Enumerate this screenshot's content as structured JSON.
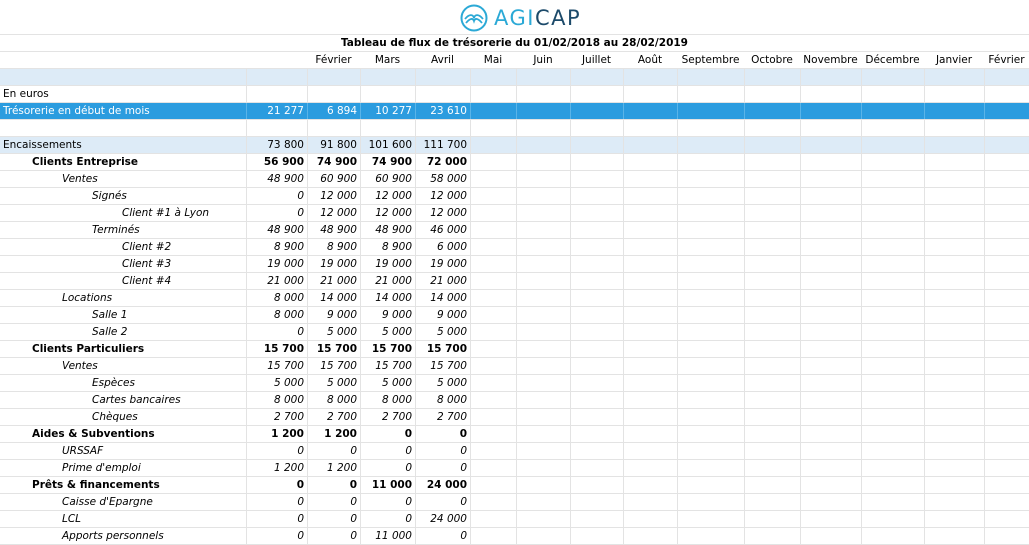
{
  "brand": {
    "part1": "AGI",
    "part2": "CAP",
    "logo_icon": "agicap-wave-icon"
  },
  "title": "Tableau de flux de trésorerie du 01/02/2018 au 28/02/2019",
  "months": [
    "Février",
    "Mars",
    "Avril",
    "Mai",
    "Juin",
    "Juillet",
    "Août",
    "Septembre",
    "Octobre",
    "Novembre",
    "Décembre",
    "Janvier",
    "Février"
  ],
  "colors": {
    "highlight": "#2b9cdf",
    "light": "#ddebf7",
    "grid": "#e3e3e3",
    "brand_light": "#2ba9d6",
    "brand_dark": "#1c4a6a"
  },
  "rows": [
    {
      "kind": "light",
      "label": "",
      "values": []
    },
    {
      "kind": "plain",
      "label": "En euros",
      "values": []
    },
    {
      "kind": "blue",
      "label": "Trésorerie en début de mois",
      "values": [
        "21 277",
        "6 894",
        "10 277",
        "23 610"
      ]
    },
    {
      "kind": "plain",
      "label": "",
      "values": []
    },
    {
      "kind": "light",
      "label": "Encaissements",
      "values": [
        "73 800",
        "91 800",
        "101 600",
        "111 700"
      ]
    },
    {
      "kind": "bold",
      "indent": 1,
      "label": "Clients Entreprise",
      "values": [
        "56 900",
        "74 900",
        "74 900",
        "72 000"
      ]
    },
    {
      "kind": "ital",
      "indent": 2,
      "label": "Ventes",
      "values": [
        "48 900",
        "60 900",
        "60 900",
        "58 000"
      ]
    },
    {
      "kind": "ital",
      "indent": 3,
      "label": "Signés",
      "values": [
        "0",
        "12 000",
        "12 000",
        "12 000"
      ]
    },
    {
      "kind": "ital",
      "indent": 4,
      "label": "Client #1 à Lyon",
      "values": [
        "0",
        "12 000",
        "12 000",
        "12 000"
      ]
    },
    {
      "kind": "ital",
      "indent": 3,
      "label": "Terminés",
      "values": [
        "48 900",
        "48 900",
        "48 900",
        "46 000"
      ]
    },
    {
      "kind": "ital",
      "indent": 4,
      "label": "Client #2",
      "values": [
        "8 900",
        "8 900",
        "8 900",
        "6 000"
      ]
    },
    {
      "kind": "ital",
      "indent": 4,
      "label": "Client #3",
      "values": [
        "19 000",
        "19 000",
        "19 000",
        "19 000"
      ]
    },
    {
      "kind": "ital",
      "indent": 4,
      "label": "Client #4",
      "values": [
        "21 000",
        "21 000",
        "21 000",
        "21 000"
      ]
    },
    {
      "kind": "ital",
      "indent": 2,
      "label": "Locations",
      "values": [
        "8 000",
        "14 000",
        "14 000",
        "14 000"
      ]
    },
    {
      "kind": "ital",
      "indent": 3,
      "label": "Salle 1",
      "values": [
        "8 000",
        "9 000",
        "9 000",
        "9 000"
      ]
    },
    {
      "kind": "ital",
      "indent": 3,
      "label": "Salle 2",
      "values": [
        "0",
        "5 000",
        "5 000",
        "5 000"
      ]
    },
    {
      "kind": "bold",
      "indent": 1,
      "label": "Clients Particuliers",
      "values": [
        "15 700",
        "15 700",
        "15 700",
        "15 700"
      ]
    },
    {
      "kind": "ital",
      "indent": 2,
      "label": "Ventes",
      "values": [
        "15 700",
        "15 700",
        "15 700",
        "15 700"
      ]
    },
    {
      "kind": "ital",
      "indent": 3,
      "label": "Espèces",
      "values": [
        "5 000",
        "5 000",
        "5 000",
        "5 000"
      ]
    },
    {
      "kind": "ital",
      "indent": 3,
      "label": "Cartes bancaires",
      "values": [
        "8 000",
        "8 000",
        "8 000",
        "8 000"
      ]
    },
    {
      "kind": "ital",
      "indent": 3,
      "label": "Chèques",
      "values": [
        "2 700",
        "2 700",
        "2 700",
        "2 700"
      ]
    },
    {
      "kind": "bold",
      "indent": 1,
      "label": "Aides & Subventions",
      "values": [
        "1 200",
        "1 200",
        "0",
        "0"
      ]
    },
    {
      "kind": "ital",
      "indent": 2,
      "label": "URSSAF",
      "values": [
        "0",
        "0",
        "0",
        "0"
      ]
    },
    {
      "kind": "ital",
      "indent": 2,
      "label": "Prime d'emploi",
      "values": [
        "1 200",
        "1 200",
        "0",
        "0"
      ]
    },
    {
      "kind": "bold",
      "indent": 1,
      "label": "Prêts & financements",
      "values": [
        "0",
        "0",
        "11 000",
        "24 000"
      ]
    },
    {
      "kind": "ital",
      "indent": 2,
      "label": "Caisse d'Epargne",
      "values": [
        "0",
        "0",
        "0",
        "0"
      ]
    },
    {
      "kind": "ital",
      "indent": 2,
      "label": "LCL",
      "values": [
        "0",
        "0",
        "0",
        "24 000"
      ]
    },
    {
      "kind": "ital",
      "indent": 2,
      "label": "Apports personnels",
      "values": [
        "0",
        "0",
        "11 000",
        "0"
      ]
    }
  ]
}
